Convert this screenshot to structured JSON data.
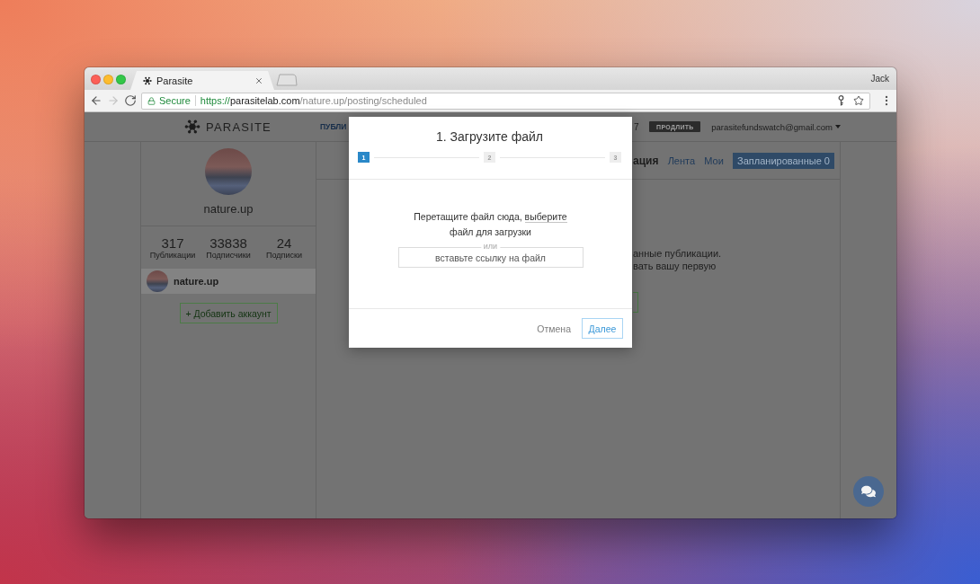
{
  "browser": {
    "tabs": [
      {
        "title": "Parasite",
        "selected": true
      }
    ],
    "user": "Jack",
    "nav_buttons": [
      {
        "kind": "back",
        "disabled": false
      },
      {
        "kind": "forward",
        "disabled": true
      },
      {
        "kind": "reload",
        "disabled": false
      }
    ],
    "address": {
      "secure_label": "Secure",
      "scheme": "https://",
      "host": "parasitelab.com",
      "path": "/nature.up/posting/scheduled"
    }
  },
  "header": {
    "logo": "PARASITE",
    "nav_fragment": "ПУБЛИ",
    "count_fragment": "7",
    "renew_button": "ПРОДЛИТЬ",
    "account_email": "parasitefundswatch@gmail.com"
  },
  "sidebar": {
    "profile_name": "nature.up",
    "stats": [
      {
        "value": "317",
        "label": "Публикации"
      },
      {
        "value": "33838",
        "label": "Подписчики"
      },
      {
        "value": "24",
        "label": "Подписки"
      }
    ],
    "accounts": [
      {
        "name": "nature.up",
        "selected": true
      }
    ],
    "add_account_button": "+ Добавить аккаунт"
  },
  "main": {
    "section_fragment": "ация",
    "tabs": [
      {
        "label": "Лента",
        "selected": false
      },
      {
        "label": "Мои",
        "selected": false
      },
      {
        "label": "Запланированные 0",
        "selected": true
      }
    ],
    "message_lines": [
      "анные публикации.",
      "вать вашу первую"
    ]
  },
  "dialog": {
    "title": "1. Загрузите файл",
    "steps": [
      {
        "label": "1",
        "selected": true
      },
      {
        "label": "2",
        "selected": false
      },
      {
        "label": "3",
        "selected": false
      }
    ],
    "instructions": {
      "text_before": "Перетащите файл сюда,",
      "link": "выберите",
      "text_after": "файл для загрузки"
    },
    "link_field": {
      "divider_label": "или",
      "placeholder": "вставьте ссылку на файл"
    },
    "buttons": [
      {
        "label": "Отмена",
        "kind": "text"
      },
      {
        "label": "Далее",
        "kind": "outline"
      }
    ]
  }
}
